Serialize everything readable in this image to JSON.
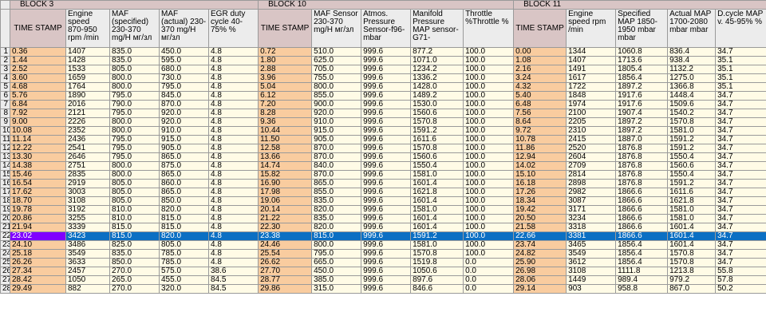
{
  "blocks": [
    "BLOCK 3",
    "BLOCK 10",
    "BLOCK 11"
  ],
  "headers": [
    "TIME STAMP",
    "Engine speed 870-950 rpm /min",
    "MAF (specified) 230-370 mg/H мг/зл",
    "MAF (actual) 230-370 mg/H мг/зл",
    "EGR duty cycle 40-75% %",
    "TIME STAMP",
    "MAF Sensor 230-370 mg/H мг/зл",
    "Atmos. Pressure Sensor-f96- mbar",
    "Manifold Pressure MAP sensor-G71-",
    "Throttle %Throttle %",
    "TIME STAMP",
    "Engine speed rpm /min",
    "Specified MAP 1850-1950 mbar mbar",
    "Actual MAP 1700-2080 mbar mbar",
    "D.cycle MAP v. 45-95% %"
  ],
  "rows": [
    [
      "1",
      "0.36",
      "1407",
      "835.0",
      "450.0",
      "4.8",
      "0.72",
      "510.0",
      "999.6",
      "877.2",
      "100.0",
      "0.00",
      "1344",
      "1060.8",
      "836.4",
      "34.7"
    ],
    [
      "2",
      "1.44",
      "1428",
      "835.0",
      "595.0",
      "4.8",
      "1.80",
      "625.0",
      "999.6",
      "1071.0",
      "100.0",
      "1.08",
      "1407",
      "1713.6",
      "938.4",
      "35.1"
    ],
    [
      "3",
      "2.52",
      "1533",
      "805.0",
      "680.0",
      "4.8",
      "2.88",
      "705.0",
      "999.6",
      "1234.2",
      "100.0",
      "2.16",
      "1491",
      "1805.4",
      "1132.2",
      "35.1"
    ],
    [
      "4",
      "3.60",
      "1659",
      "800.0",
      "730.0",
      "4.8",
      "3.96",
      "755.0",
      "999.6",
      "1336.2",
      "100.0",
      "3.24",
      "1617",
      "1856.4",
      "1275.0",
      "35.1"
    ],
    [
      "5",
      "4.68",
      "1764",
      "800.0",
      "795.0",
      "4.8",
      "5.04",
      "800.0",
      "999.6",
      "1428.0",
      "100.0",
      "4.32",
      "1722",
      "1897.2",
      "1366.8",
      "35.1"
    ],
    [
      "6",
      "5.76",
      "1890",
      "795.0",
      "845.0",
      "4.8",
      "6.12",
      "855.0",
      "999.6",
      "1489.2",
      "100.0",
      "5.40",
      "1848",
      "1917.6",
      "1448.4",
      "34.7"
    ],
    [
      "7",
      "6.84",
      "2016",
      "790.0",
      "870.0",
      "4.8",
      "7.20",
      "900.0",
      "999.6",
      "1530.0",
      "100.0",
      "6.48",
      "1974",
      "1917.6",
      "1509.6",
      "34.7"
    ],
    [
      "8",
      "7.92",
      "2121",
      "795.0",
      "920.0",
      "4.8",
      "8.28",
      "920.0",
      "999.6",
      "1560.6",
      "100.0",
      "7.56",
      "2100",
      "1907.4",
      "1540.2",
      "34.7"
    ],
    [
      "9",
      "9.00",
      "2226",
      "800.0",
      "920.0",
      "4.8",
      "9.36",
      "910.0",
      "999.6",
      "1570.8",
      "100.0",
      "8.64",
      "2205",
      "1897.2",
      "1570.8",
      "34.7"
    ],
    [
      "10",
      "10.08",
      "2352",
      "800.0",
      "910.0",
      "4.8",
      "10.44",
      "915.0",
      "999.6",
      "1591.2",
      "100.0",
      "9.72",
      "2310",
      "1897.2",
      "1581.0",
      "34.7"
    ],
    [
      "11",
      "11.14",
      "2436",
      "795.0",
      "915.0",
      "4.8",
      "11.50",
      "905.0",
      "999.6",
      "1611.6",
      "100.0",
      "10.78",
      "2415",
      "1887.0",
      "1591.2",
      "34.7"
    ],
    [
      "12",
      "12.22",
      "2541",
      "795.0",
      "905.0",
      "4.8",
      "12.58",
      "870.0",
      "999.6",
      "1570.8",
      "100.0",
      "11.86",
      "2520",
      "1876.8",
      "1591.2",
      "34.7"
    ],
    [
      "13",
      "13.30",
      "2646",
      "795.0",
      "865.0",
      "4.8",
      "13.66",
      "870.0",
      "999.6",
      "1560.6",
      "100.0",
      "12.94",
      "2604",
      "1876.8",
      "1550.4",
      "34.7"
    ],
    [
      "14",
      "14.38",
      "2751",
      "800.0",
      "875.0",
      "4.8",
      "14.74",
      "840.0",
      "999.6",
      "1550.4",
      "100.0",
      "14.02",
      "2709",
      "1876.8",
      "1560.6",
      "34.7"
    ],
    [
      "15",
      "15.46",
      "2835",
      "800.0",
      "865.0",
      "4.8",
      "15.82",
      "870.0",
      "999.6",
      "1581.0",
      "100.0",
      "15.10",
      "2814",
      "1876.8",
      "1550.4",
      "34.7"
    ],
    [
      "16",
      "16.54",
      "2919",
      "805.0",
      "860.0",
      "4.8",
      "16.90",
      "865.0",
      "999.6",
      "1601.4",
      "100.0",
      "16.18",
      "2898",
      "1876.8",
      "1591.2",
      "34.7"
    ],
    [
      "17",
      "17.62",
      "3003",
      "805.0",
      "865.0",
      "4.8",
      "17.98",
      "855.0",
      "999.6",
      "1621.8",
      "100.0",
      "17.26",
      "2982",
      "1866.6",
      "1611.6",
      "34.7"
    ],
    [
      "18",
      "18.70",
      "3108",
      "805.0",
      "850.0",
      "4.8",
      "19.06",
      "835.0",
      "999.6",
      "1601.4",
      "100.0",
      "18.34",
      "3087",
      "1866.6",
      "1621.8",
      "34.7"
    ],
    [
      "19",
      "19.78",
      "3192",
      "810.0",
      "820.0",
      "4.8",
      "20.14",
      "820.0",
      "999.6",
      "1581.0",
      "100.0",
      "19.42",
      "3171",
      "1866.6",
      "1581.0",
      "34.7"
    ],
    [
      "20",
      "20.86",
      "3255",
      "810.0",
      "815.0",
      "4.8",
      "21.22",
      "835.0",
      "999.6",
      "1601.4",
      "100.0",
      "20.50",
      "3234",
      "1866.6",
      "1581.0",
      "34.7"
    ],
    [
      "21",
      "21.94",
      "3339",
      "815.0",
      "815.0",
      "4.8",
      "22.30",
      "820.0",
      "999.6",
      "1601.4",
      "100.0",
      "21.58",
      "3318",
      "1866.6",
      "1601.4",
      "34.7"
    ],
    [
      "22",
      "23.02",
      "3423",
      "815.0",
      "820.0",
      "4.8",
      "23.38",
      "815.0",
      "999.6",
      "1591.2",
      "100.0",
      "22.66",
      "3381",
      "1866.6",
      "1601.4",
      "34.7"
    ],
    [
      "23",
      "24.10",
      "3486",
      "825.0",
      "805.0",
      "4.8",
      "24.46",
      "800.0",
      "999.6",
      "1581.0",
      "100.0",
      "23.74",
      "3465",
      "1856.4",
      "1601.4",
      "34.7"
    ],
    [
      "24",
      "25.18",
      "3549",
      "835.0",
      "785.0",
      "4.8",
      "25.54",
      "795.0",
      "999.6",
      "1570.8",
      "100.0",
      "24.82",
      "3549",
      "1856.4",
      "1570.8",
      "34.7"
    ],
    [
      "25",
      "26.26",
      "3633",
      "850.0",
      "785.0",
      "4.8",
      "26.62",
      "665.0",
      "999.6",
      "1519.8",
      "0.0",
      "25.90",
      "3612",
      "1856.4",
      "1570.8",
      "34.7"
    ],
    [
      "26",
      "27.34",
      "2457",
      "270.0",
      "575.0",
      "38.6",
      "27.70",
      "450.0",
      "999.6",
      "1050.6",
      "0.0",
      "26.98",
      "3108",
      "1111.8",
      "1213.8",
      "55.8"
    ],
    [
      "27",
      "28.42",
      "1050",
      "265.0",
      "455.0",
      "84.5",
      "28.77",
      "385.0",
      "999.6",
      "897.6",
      "0.0",
      "28.06",
      "1449",
      "989.4",
      "979.2",
      "57.8"
    ],
    [
      "28",
      "29.49",
      "882",
      "270.0",
      "320.0",
      "84.5",
      "29.86",
      "315.0",
      "999.6",
      "846.6",
      "0.0",
      "29.14",
      "903",
      "958.8",
      "867.0",
      "50.2"
    ]
  ],
  "selected_row": "22"
}
